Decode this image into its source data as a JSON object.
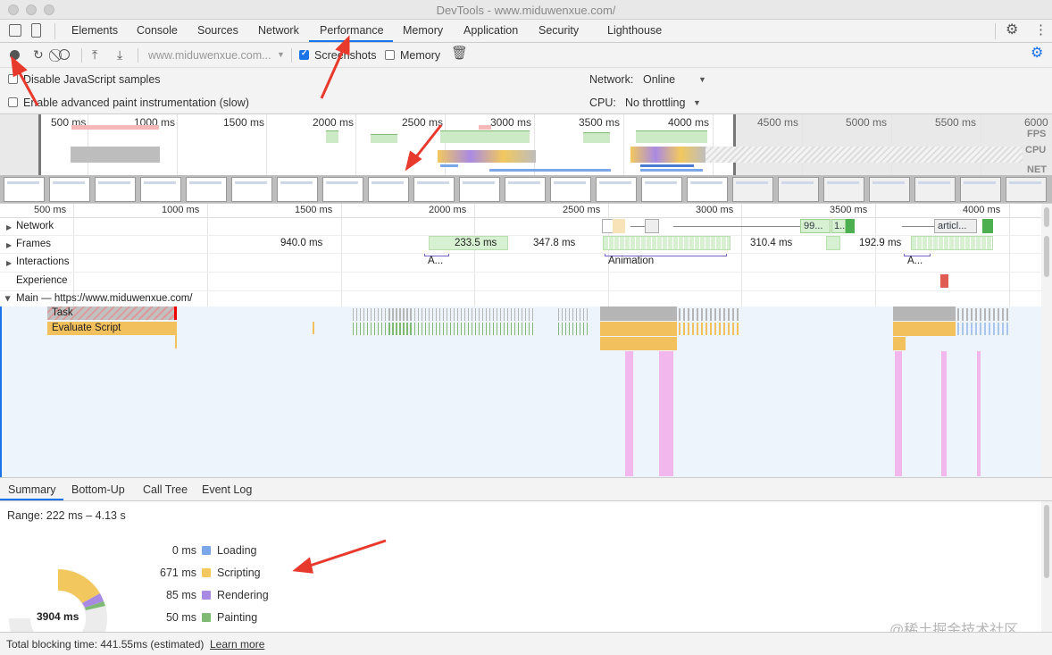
{
  "window": {
    "title": "DevTools - www.miduwenxue.com/"
  },
  "tabs": [
    {
      "label": "Elements",
      "active": false
    },
    {
      "label": "Console",
      "active": false
    },
    {
      "label": "Sources",
      "active": false
    },
    {
      "label": "Network",
      "active": false
    },
    {
      "label": "Performance",
      "active": true
    },
    {
      "label": "Memory",
      "active": false
    },
    {
      "label": "Application",
      "active": false
    },
    {
      "label": "Security",
      "active": false
    },
    {
      "label": "Lighthouse",
      "active": false
    }
  ],
  "toolbar": {
    "profile_select": "www.miduwenxue.com...",
    "screenshots_label": "Screenshots",
    "screenshots_checked": true,
    "memory_label": "Memory",
    "memory_checked": false,
    "icons": [
      "record-icon",
      "reload-icon",
      "clear-icon",
      "upload-icon",
      "download-icon",
      "trash-icon",
      "settings-gear-icon"
    ]
  },
  "settings": {
    "disable_js_samples": "Disable JavaScript samples",
    "advanced_paint": "Enable advanced paint instrumentation (slow)",
    "network_label": "Network:",
    "network_value": "Online",
    "cpu_label": "CPU:",
    "cpu_value": "No throttling"
  },
  "overview": {
    "ticks": [
      "500 ms",
      "1000 ms",
      "1500 ms",
      "2000 ms",
      "2500 ms",
      "3000 ms",
      "3500 ms",
      "4000 ms",
      "4500 ms",
      "5000 ms",
      "5500 ms",
      "6000"
    ],
    "lanes": [
      "FPS",
      "CPU",
      "NET"
    ]
  },
  "timeline": {
    "ticks": [
      "500 ms",
      "1000 ms",
      "1500 ms",
      "2000 ms",
      "2500 ms",
      "3000 ms",
      "3500 ms",
      "4000 ms"
    ],
    "tracks": [
      "Network",
      "Frames",
      "Interactions",
      "Experience"
    ],
    "frame_labels": [
      "940.0 ms",
      "233.5 ms",
      "347.8 ms",
      "310.4 ms",
      "192.9 ms"
    ],
    "network_labels": [
      "99...",
      "1...",
      "articl..."
    ],
    "interaction_labels": [
      "A...",
      "Animation",
      "A..."
    ],
    "main_title": "Main — https://www.miduwenxue.com/",
    "task_label": "Task",
    "evaluate_label": "Evaluate Script"
  },
  "bottom_tabs": [
    {
      "label": "Summary",
      "active": true
    },
    {
      "label": "Bottom-Up",
      "active": false
    },
    {
      "label": "Call Tree",
      "active": false
    },
    {
      "label": "Event Log",
      "active": false
    }
  ],
  "summary": {
    "range": "Range: 222 ms – 4.13 s",
    "total": "3904 ms",
    "legend": [
      {
        "value": "0 ms",
        "label": "Loading",
        "color": "#7aa7e8"
      },
      {
        "value": "671 ms",
        "label": "Scripting",
        "color": "#f2c85e"
      },
      {
        "value": "85 ms",
        "label": "Rendering",
        "color": "#a98ae3"
      },
      {
        "value": "50 ms",
        "label": "Painting",
        "color": "#7fba74"
      }
    ]
  },
  "status": {
    "blocking": "Total blocking time: 441.55ms (estimated)",
    "learn_more": "Learn more"
  },
  "watermark": "@稀土掘金技术社区",
  "colors": {
    "accent": "#1a73e8",
    "annotation": "#e8392d",
    "scripting": "#f2c85e",
    "painting": "#7fba74",
    "rendering": "#a98ae3",
    "loading": "#7aa7e8"
  }
}
